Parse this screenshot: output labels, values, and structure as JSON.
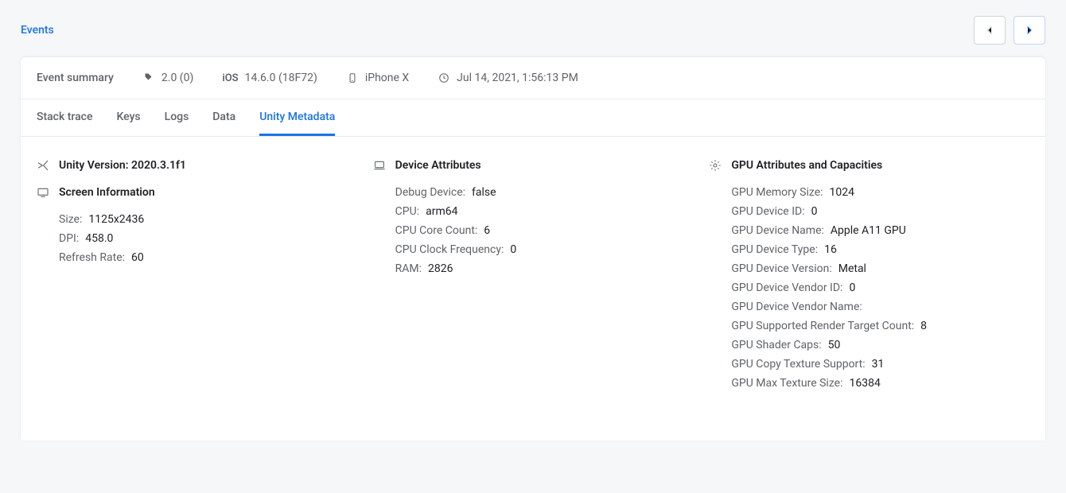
{
  "page_title": "Events",
  "summary": {
    "label": "Event summary",
    "version": "2.0 (0)",
    "os": "14.6.0 (18F72)",
    "device": "iPhone X",
    "timestamp": "Jul 14, 2021, 1:56:13 PM"
  },
  "tabs": {
    "stack_trace": "Stack trace",
    "keys": "Keys",
    "logs": "Logs",
    "data": "Data",
    "unity_metadata": "Unity Metadata"
  },
  "unity": {
    "version_label": "Unity Version: 2020.3.1f1",
    "screen": {
      "heading": "Screen Information",
      "size_k": "Size:",
      "size_v": "1125x2436",
      "dpi_k": "DPI:",
      "dpi_v": "458.0",
      "refresh_k": "Refresh Rate:",
      "refresh_v": "60"
    },
    "device": {
      "heading": "Device Attributes",
      "debug_k": "Debug Device:",
      "debug_v": "false",
      "cpu_k": "CPU:",
      "cpu_v": "arm64",
      "cores_k": "CPU Core Count:",
      "cores_v": "6",
      "clock_k": "CPU Clock Frequency:",
      "clock_v": "0",
      "ram_k": "RAM:",
      "ram_v": "2826"
    },
    "gpu": {
      "heading": "GPU Attributes and Capacities",
      "mem_k": "GPU Memory Size:",
      "mem_v": "1024",
      "devid_k": "GPU Device ID:",
      "devid_v": "0",
      "devname_k": "GPU Device Name:",
      "devname_v": "Apple A11 GPU",
      "devtype_k": "GPU Device Type:",
      "devtype_v": "16",
      "devver_k": "GPU Device Version:",
      "devver_v": "Metal",
      "vendid_k": "GPU Device Vendor ID:",
      "vendid_v": "0",
      "vendname_k": "GPU Device Vendor Name:",
      "vendname_v": "",
      "rtc_k": "GPU Supported Render Target Count:",
      "rtc_v": "8",
      "shader_k": "GPU Shader Caps:",
      "shader_v": "50",
      "copytex_k": "GPU Copy Texture Support:",
      "copytex_v": "31",
      "maxtex_k": "GPU Max Texture Size:",
      "maxtex_v": "16384"
    }
  }
}
